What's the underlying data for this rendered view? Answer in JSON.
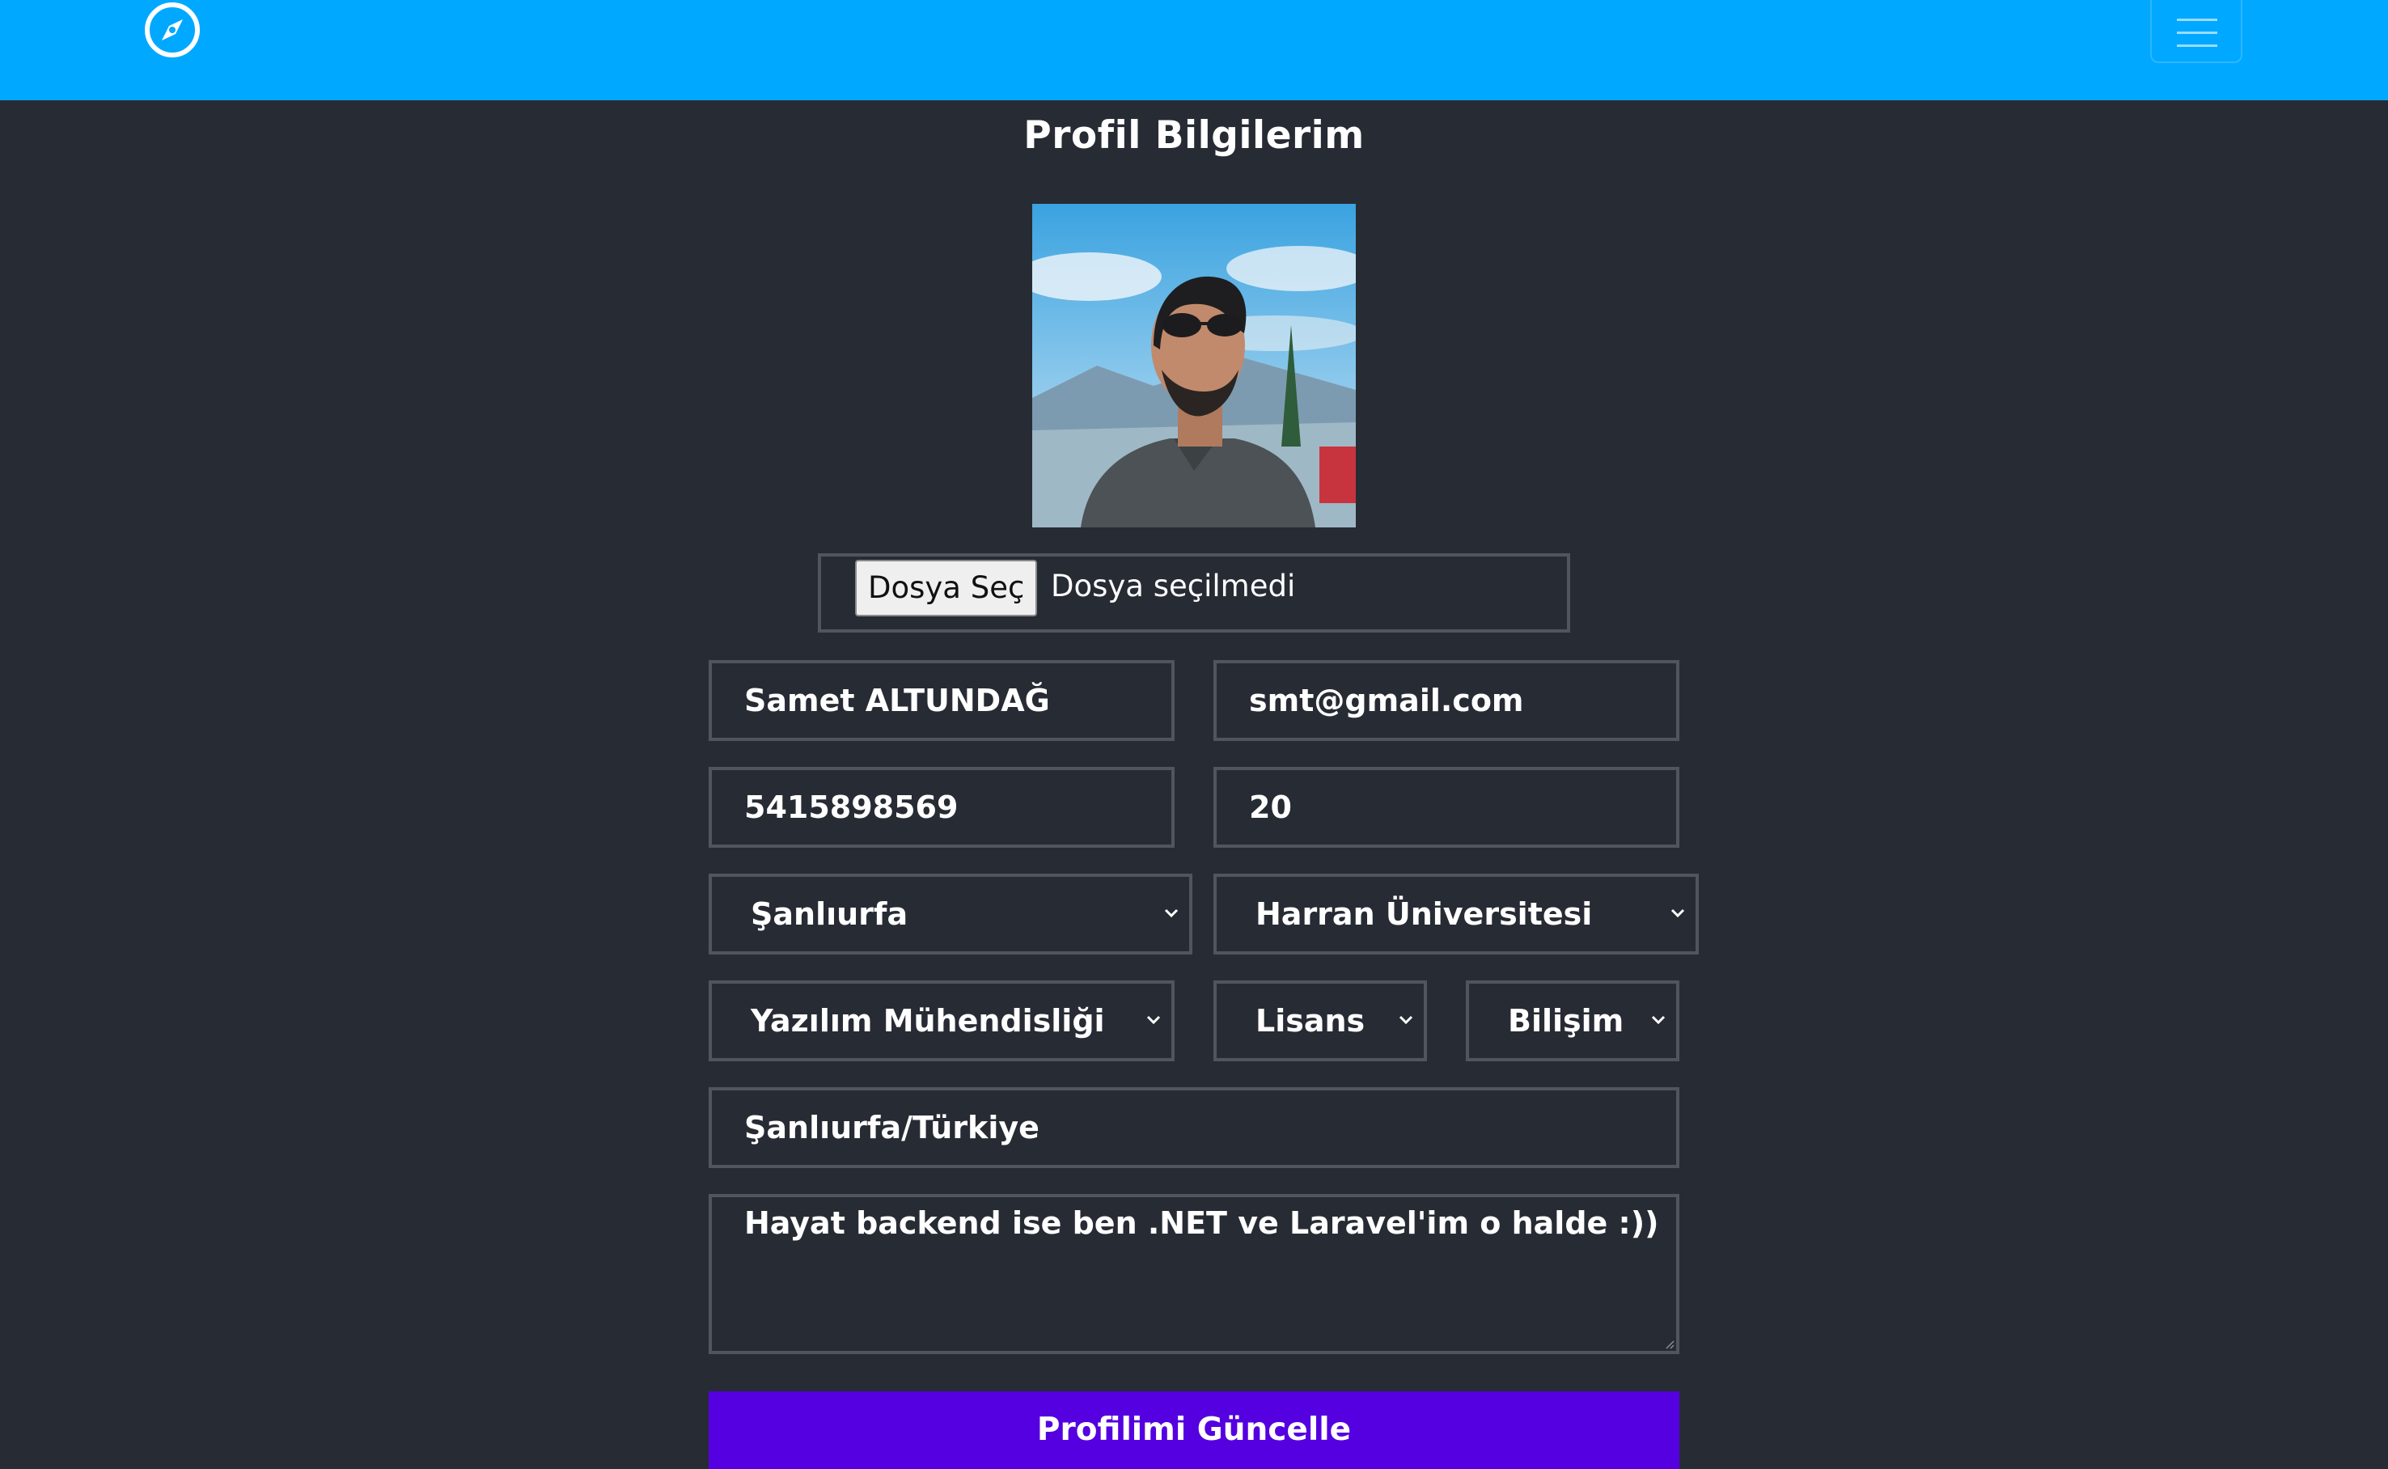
{
  "navbar": {
    "brand_icon": "compass-icon",
    "menu_icon": "hamburger-menu-icon",
    "background": "#00a8ff"
  },
  "page": {
    "title": "Profil Bilgilerim"
  },
  "avatar": {
    "description_icon": "profile-photo"
  },
  "file_input": {
    "button_label": "Dosya Seç",
    "status": "Dosya seçilmedi"
  },
  "form": {
    "full_name": "Samet ALTUNDAĞ",
    "email": "smt@gmail.com",
    "phone": "5415898569",
    "age": "20",
    "city": "Şanlıurfa",
    "university": "Harran Üniversitesi",
    "department": "Yazılım Mühendisliği",
    "degree": "Lisans",
    "faculty": "Bilişim",
    "address": "Şanlıurfa/Türkiye",
    "bio": "Hayat backend ise ben .NET ve Laravel'im o halde :))"
  },
  "submit": {
    "label": "Profilimi Güncelle",
    "color": "#5400e0"
  },
  "colors": {
    "page_background": "#272b34",
    "field_border": "#50555e"
  }
}
